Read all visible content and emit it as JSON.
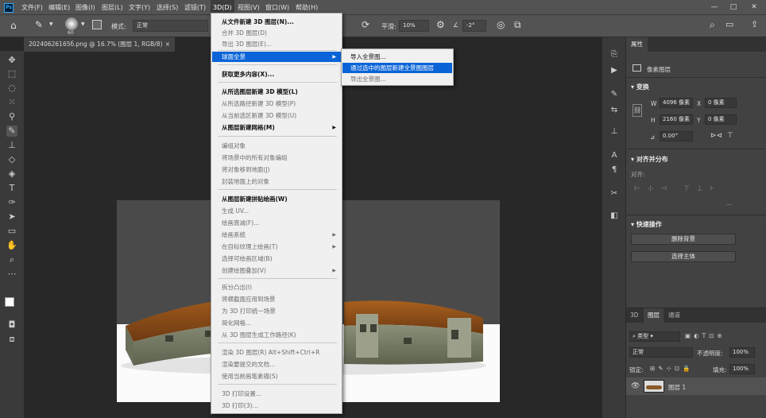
{
  "app": {
    "logo": "Ps"
  },
  "menubar": {
    "items": [
      "文件(F)",
      "编辑(E)",
      "图像(I)",
      "图层(L)",
      "文字(Y)",
      "选择(S)",
      "滤镜(T)",
      "3D(D)",
      "视图(V)",
      "窗口(W)",
      "帮助(H)"
    ],
    "active": "3D(D)",
    "window_controls": [
      "—",
      "□",
      "✕"
    ]
  },
  "options": {
    "brush_size": "60",
    "mode_label": "模式:",
    "mode_value": "正常",
    "smooth_label": "平滑:",
    "smooth_value": "10%",
    "angle_value": "-2°"
  },
  "document": {
    "tab_title": "20240626165б.png @ 16.7% (图层 1, RGB/8)",
    "tab_close": "×"
  },
  "menu_3d": {
    "items": [
      {
        "label": "从文件新建 3D 图层(N)...",
        "state": "enabled"
      },
      {
        "label": "合并 3D 图层(D)",
        "state": "disabled"
      },
      {
        "label": "导出 3D 图层(E)...",
        "state": "disabled"
      },
      {
        "label": "球面全景",
        "state": "highlight",
        "arrow": "▶"
      },
      {
        "label": "获取更多内容(X)...",
        "state": "enabled"
      },
      {
        "label": "从所选图层新建 3D 模型(L)",
        "state": "enabled"
      },
      {
        "label": "从所选路径新建 3D 模型(P)",
        "state": "disabled"
      },
      {
        "label": "从当前选区新建 3D 模型(U)",
        "state": "disabled"
      },
      {
        "label": "从图层新建网格(M)",
        "state": "enabled",
        "arrow": "▶"
      },
      {
        "label": "编组对象",
        "state": "disabled"
      },
      {
        "label": "将场景中的所有对象编组",
        "state": "disabled"
      },
      {
        "label": "将对象移到地面(J)",
        "state": "disabled"
      },
      {
        "label": "封装地面上的对象",
        "state": "disabled"
      },
      {
        "label": "从图层新建拼贴绘画(W)",
        "state": "enabled"
      },
      {
        "label": "生成 UV...",
        "state": "disabled"
      },
      {
        "label": "绘画衰减(F)...",
        "state": "disabled"
      },
      {
        "label": "绘画系统",
        "state": "disabled",
        "arrow": "▶"
      },
      {
        "label": "在目标纹理上绘画(T)",
        "state": "disabled",
        "arrow": "▶"
      },
      {
        "label": "选择可绘画区域(B)",
        "state": "disabled"
      },
      {
        "label": "创建绘图叠加(V)",
        "state": "disabled",
        "arrow": "▶"
      },
      {
        "label": "拆分凸出(I)",
        "state": "disabled"
      },
      {
        "label": "将横截面应用到场景",
        "state": "disabled"
      },
      {
        "label": "为 3D 打印统一场景",
        "state": "disabled"
      },
      {
        "label": "简化网格...",
        "state": "disabled"
      },
      {
        "label": "从 3D 图层生成工作路径(K)",
        "state": "disabled"
      },
      {
        "label": "渲染 3D 图层(R)     Alt+Shift+Ctrl+R",
        "state": "disabled"
      },
      {
        "label": "渲染要提交的文档...",
        "state": "disabled"
      },
      {
        "label": "使用当前画笔素描(S)",
        "state": "disabled"
      },
      {
        "label": "3D 打印设置...",
        "state": "disabled"
      },
      {
        "label": "3D 打印(3)...",
        "state": "disabled"
      }
    ]
  },
  "submenu_panorama": {
    "items": [
      {
        "label": "导入全景图...",
        "state": "enabled"
      },
      {
        "label": "通过选中的图层新建全景图图层",
        "state": "highlight"
      },
      {
        "label": "导出全景图...",
        "state": "disabled"
      }
    ]
  },
  "properties": {
    "tab": "属性",
    "layer_type": "像素图层",
    "transform_title": "变换",
    "w_label": "W",
    "w_value": "4096 像素",
    "x_label": "X",
    "x_value": "0 像素",
    "h_label": "H",
    "h_value": "2160 像素",
    "y_label": "Y",
    "y_value": "0 像素",
    "angle_value": "0.00°",
    "align_title": "对齐并分布",
    "align_label": "对齐:",
    "quick_title": "快速操作",
    "remove_bg": "删除背景",
    "select_subject": "选择主体",
    "more": "..."
  },
  "layers": {
    "tabs": [
      "3D",
      "图层",
      "通道"
    ],
    "active_tab": "图层",
    "filter_label": "类型",
    "blend_mode": "正常",
    "opacity_label": "不透明度:",
    "opacity_value": "100%",
    "lock_label": "锁定:",
    "fill_label": "填充:",
    "fill_value": "100%",
    "layer_name": "图层 1"
  }
}
